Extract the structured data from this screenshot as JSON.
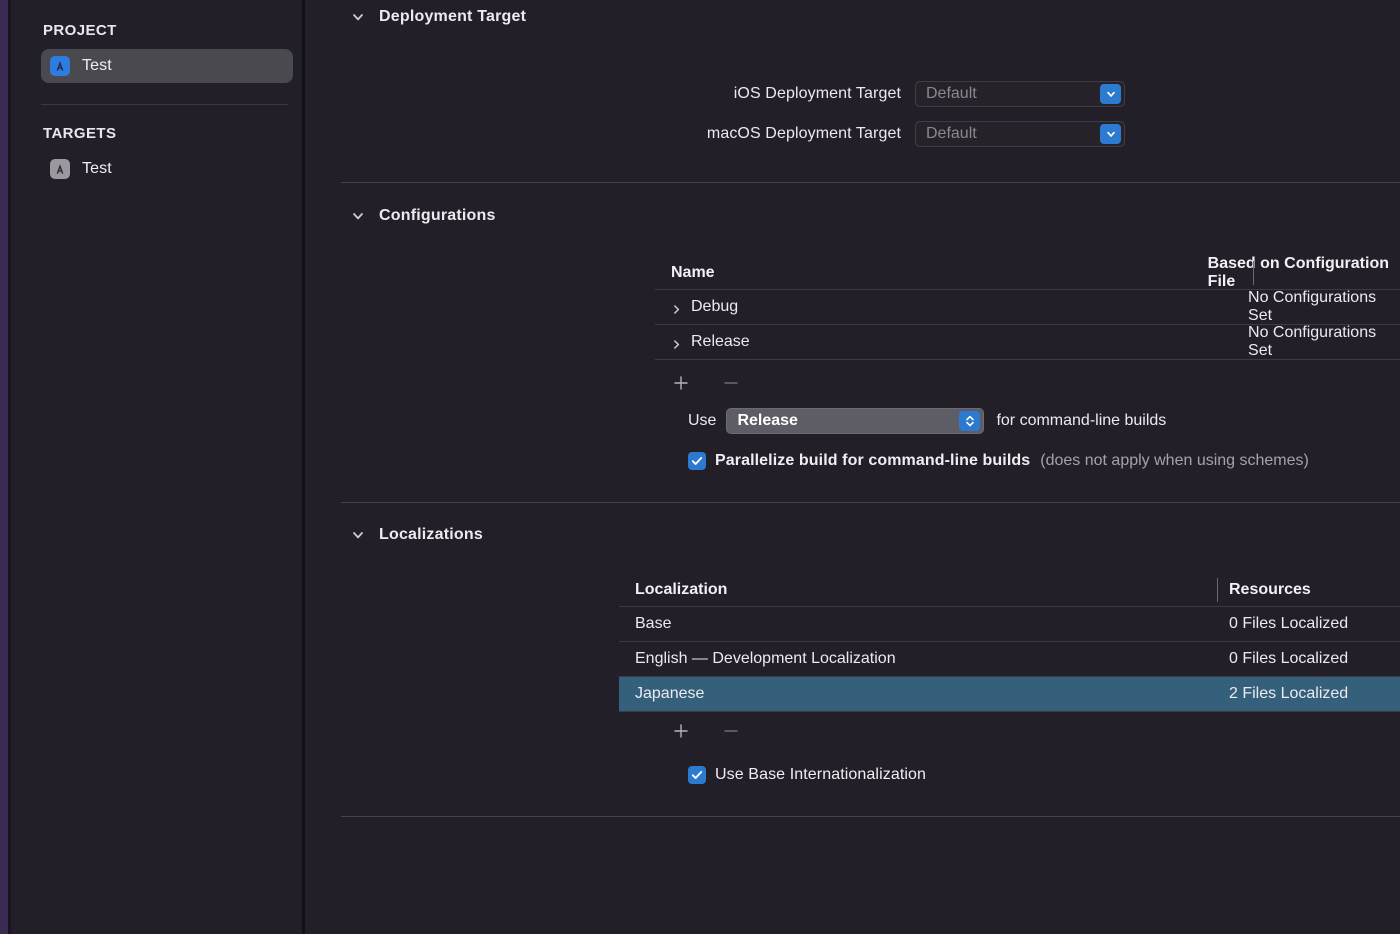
{
  "sidebar": {
    "project_header": "PROJECT",
    "targets_header": "TARGETS",
    "project_items": [
      {
        "label": "Test",
        "icon": "xcode-app-icon",
        "selected": true
      }
    ],
    "target_items": [
      {
        "label": "Test",
        "icon": "xcode-target-icon",
        "selected": false
      }
    ]
  },
  "sections": {
    "deployment_target": {
      "title": "Deployment Target",
      "expanded": true,
      "fields": [
        {
          "label": "iOS Deployment Target",
          "value": "Default",
          "enabled": false
        },
        {
          "label": "macOS Deployment Target",
          "value": "Default",
          "enabled": false
        }
      ]
    },
    "configurations": {
      "title": "Configurations",
      "expanded": true,
      "columns": [
        "Name",
        "Based on Configuration File"
      ],
      "rows": [
        {
          "name": "Debug",
          "based_on": "No Configurations Set"
        },
        {
          "name": "Release",
          "based_on": "No Configurations Set"
        }
      ],
      "add_button": "+",
      "remove_button": "−",
      "command_line": {
        "prefix": "Use",
        "value": "Release",
        "suffix": "for command-line builds"
      },
      "parallelize": {
        "label": "Parallelize build for command-line builds",
        "note": "(does not apply when using schemes)",
        "checked": true
      }
    },
    "localizations": {
      "title": "Localizations",
      "expanded": true,
      "columns": [
        "Localization",
        "Resources"
      ],
      "rows": [
        {
          "name": "Base",
          "resources": "0 Files Localized",
          "selected": false
        },
        {
          "name": "English — Development Localization",
          "resources": "0 Files Localized",
          "selected": false
        },
        {
          "name": "Japanese",
          "resources": "2 Files Localized",
          "selected": true
        }
      ],
      "add_button": "+",
      "remove_button": "−",
      "use_base": {
        "label": "Use Base Internationalization",
        "checked": true
      }
    }
  },
  "colors": {
    "background": "#221f28",
    "accent_blue": "#2b7ad0",
    "selected_row": "#35607c",
    "sidebar_selected": "#4b4950",
    "edge_strip": "#3a2b52"
  }
}
